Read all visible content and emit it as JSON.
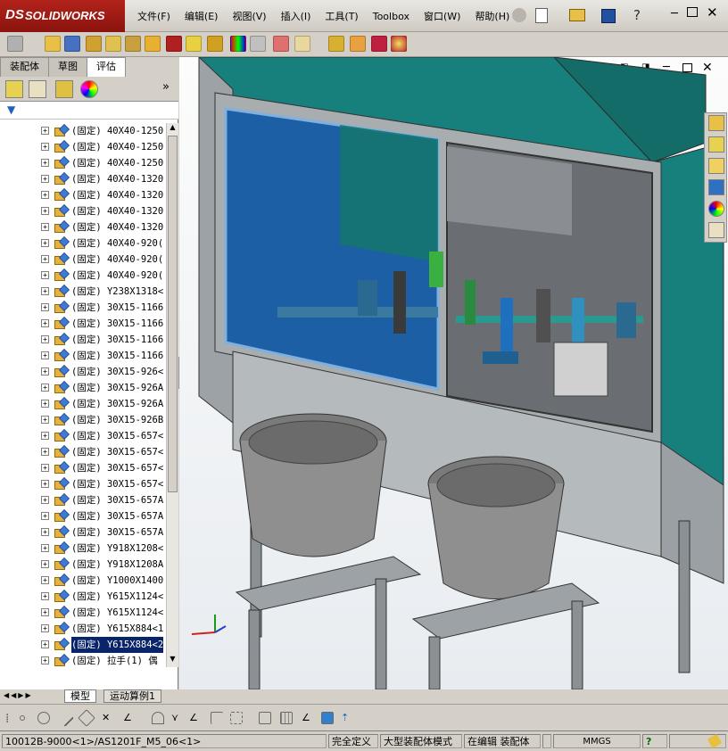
{
  "app": {
    "logo_ds": "DS",
    "logo_text": "SOLIDWORKS"
  },
  "menu": [
    "文件(F)",
    "编辑(E)",
    "视图(V)",
    "插入(I)",
    "工具(T)",
    "Toolbox",
    "窗口(W)",
    "帮助(H)"
  ],
  "left_tabs": [
    "装配体",
    "草图",
    "评估"
  ],
  "filter_icon": "filter-icon",
  "tree_items": [
    "(固定) 40X40-1250",
    "(固定) 40X40-1250",
    "(固定) 40X40-1250",
    "(固定) 40X40-1320",
    "(固定) 40X40-1320",
    "(固定) 40X40-1320",
    "(固定) 40X40-1320",
    "(固定) 40X40-920(",
    "(固定) 40X40-920(",
    "(固定) 40X40-920(",
    "(固定) Y238X1318<",
    "(固定) 30X15-1166",
    "(固定) 30X15-1166",
    "(固定) 30X15-1166",
    "(固定) 30X15-1166",
    "(固定) 30X15-926<",
    "(固定) 30X15-926A",
    "(固定) 30X15-926A",
    "(固定) 30X15-926B",
    "(固定) 30X15-657<",
    "(固定) 30X15-657<",
    "(固定) 30X15-657<",
    "(固定) 30X15-657<",
    "(固定) 30X15-657A",
    "(固定) 30X15-657A",
    "(固定) 30X15-657A",
    "(固定) Y918X1208<",
    "(固定) Y918X1208A",
    "(固定) Y1000X1400",
    "(固定) Y615X1124<",
    "(固定) Y615X1124<",
    "(固定) Y615X884<1",
    "(固定) Y615X884<2",
    "(固定) 拉手(1) 偶"
  ],
  "selected_index": 32,
  "bottom_tabs": [
    "模型",
    "运动算例1"
  ],
  "status": {
    "path": "10012B-9000<1>/AS1201F_M5_06<1>",
    "defined": "完全定义",
    "mode": "大型装配体模式",
    "editing": "在编辑 装配体",
    "units": "MMGS",
    "help": "?"
  },
  "colors": {
    "cabinet_top": "#1a8a86",
    "frame": "#9aa0a4",
    "glass": "#1d5fa5",
    "bowl": "#8f8f8f"
  }
}
